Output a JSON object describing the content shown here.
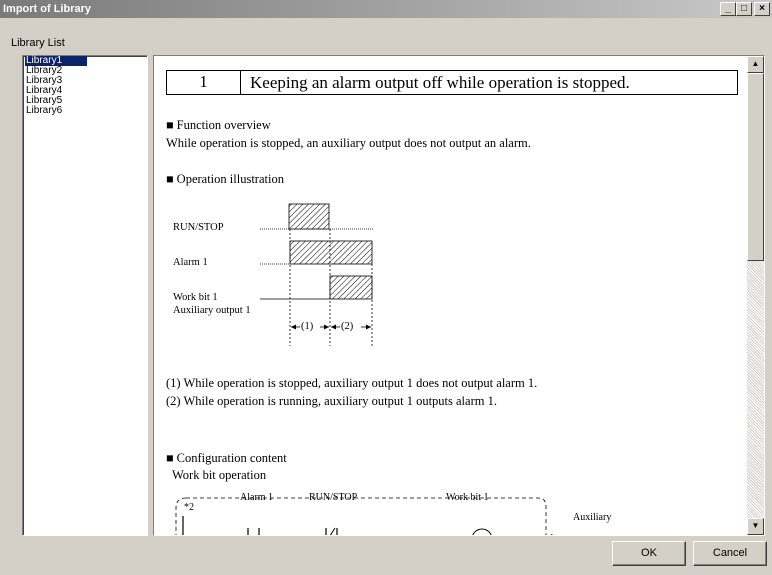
{
  "window": {
    "title": "Import of Library",
    "minimize_glyph": "_",
    "maximize_glyph": "□",
    "close_glyph": "×"
  },
  "library_list": {
    "label": "Library List",
    "items": [
      "Library1",
      "Library2",
      "Library3",
      "Library4",
      "Library5",
      "Library6"
    ],
    "selected_index": 0
  },
  "document": {
    "number": "1",
    "heading": "Keeping an alarm output off while operation is stopped.",
    "function_overview": {
      "title": "■ Function overview",
      "text": "While operation is stopped, an auxiliary output does not output an alarm."
    },
    "operation_illustration": {
      "title": "■ Operation illustration",
      "labels": {
        "run_stop": "RUN/STOP",
        "alarm1": "Alarm 1",
        "work_bit1": "Work bit 1",
        "aux_output1": "Auxiliary output 1",
        "interval1": "(1)",
        "interval2": "(2)"
      }
    },
    "notes": [
      "(1) While operation is stopped, auxiliary output 1 does not output alarm 1.",
      "(2) While operation is running, auxiliary output 1 outputs alarm 1."
    ],
    "configuration": {
      "title": "■ Configuration content",
      "subtitle": "Work bit operation",
      "ladder_labels": {
        "note": "*2",
        "alarm1": "Alarm 1",
        "run_stop": "RUN/STOP",
        "work_bit1": "Work bit 1",
        "auxiliary": "Auxiliary"
      }
    }
  },
  "buttons": {
    "ok": "OK",
    "cancel": "Cancel"
  },
  "scrollbar": {
    "up_glyph": "▲",
    "down_glyph": "▼"
  }
}
